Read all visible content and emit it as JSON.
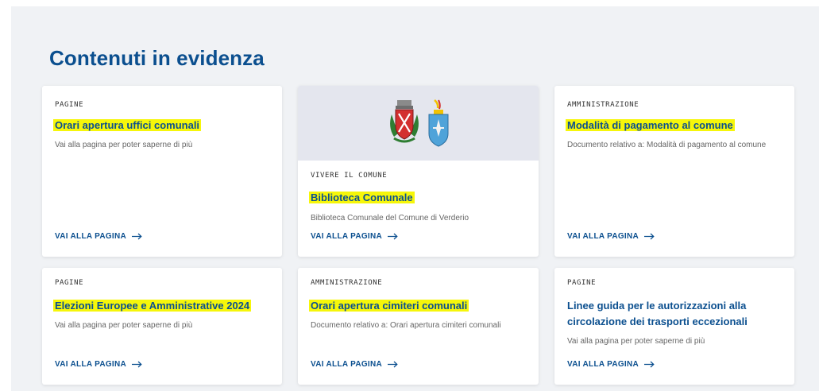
{
  "section": {
    "title": "Contenuti in evidenza"
  },
  "cards": [
    {
      "category": "PAGINE",
      "title": "Orari apertura uffici comunali",
      "highlighted": true,
      "description": "Vai alla pagina per poter saperne di più",
      "link": "VAI ALLA PAGINA"
    },
    {
      "category": "VIVERE IL COMUNE",
      "title": "Biblioteca Comunale",
      "highlighted": true,
      "description": "Biblioteca Comunale del Comune di Verderio",
      "link": "VAI ALLA PAGINA",
      "image": "coat-of-arms"
    },
    {
      "category": "AMMINISTRAZIONE",
      "title": "Modalità di pagamento al comune",
      "highlighted": true,
      "description": "Documento relativo a: Modalità di pagamento al comune",
      "link": "VAI ALLA PAGINA"
    },
    {
      "category": "PAGINE",
      "title": "Elezioni Europee e Amministrative 2024",
      "highlighted": true,
      "description": "Vai alla pagina per poter saperne di più",
      "link": "VAI ALLA PAGINA"
    },
    {
      "category": "AMMINISTRAZIONE",
      "title": "Orari apertura cimiteri comunali",
      "highlighted": true,
      "description": "Documento relativo a: Orari apertura cimiteri comunali",
      "link": "VAI ALLA PAGINA"
    },
    {
      "category": "PAGINE",
      "title": "Linee guida per le autorizzazioni alla circolazione dei trasporti eccezionali",
      "highlighted": false,
      "description": "Vai alla pagina per poter saperne di più",
      "link": "VAI ALLA PAGINA"
    }
  ],
  "colors": {
    "accent": "#0b4f8f",
    "highlight": "#f6f60a",
    "background": "#f0f2f5"
  },
  "icons": {
    "link_arrow": "arrow-right-icon"
  }
}
